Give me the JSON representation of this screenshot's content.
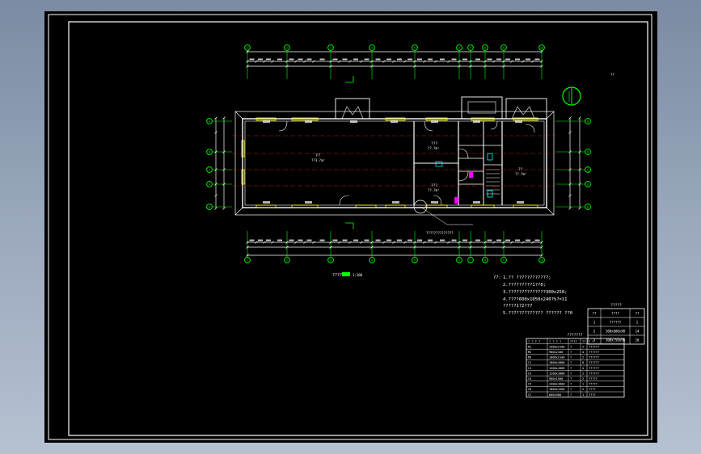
{
  "title_block": {
    "sheet_text": "??",
    "plan_title": "????",
    "plan_scale": "1:100",
    "ellipsis_label": "??????????????",
    "section_a": "A",
    "section_b": "B"
  },
  "rooms": [
    {
      "name": "??",
      "area": "??3.?m²"
    },
    {
      "name": "???",
      "area": "??.?m²"
    },
    {
      "name": "???",
      "area": "??.?m²"
    },
    {
      "name": "??",
      "area": "??.?m²"
    }
  ],
  "axes_top": [
    "1",
    "2",
    "3",
    "4",
    "5",
    "6",
    "7",
    "8",
    "9",
    "10"
  ],
  "axes_side": [
    "A",
    "B",
    "C",
    "D",
    "E"
  ],
  "notes": {
    "heading": "??:",
    "lines": [
      "1.?? ????????????;",
      "2.?????????1??0;",
      "3.??????????????300x250;",
      "4.????600x1050x240?%?=11",
      "   ?????1?2??7",
      "5.?????????????  ??????  ??0"
    ]
  },
  "table_right": {
    "title": "?????",
    "headers": [
      "??",
      "????",
      "??"
    ],
    "rows": [
      [
        "1",
        "??????",
        "1"
      ],
      [
        "2",
        "300x600x90",
        "14"
      ],
      [
        "3",
        "300x750x90",
        "10"
      ]
    ]
  },
  "table_main": {
    "title": "???????",
    "headers": [
      "? ? ? ?",
      "? ? ? ?",
      "????",
      "??",
      "? ?"
    ],
    "rows": [
      [
        "M1",
        "1500x2100",
        "?",
        "2",
        "??????"
      ],
      [
        "M2",
        "900x2100",
        "?",
        "4",
        "??????"
      ],
      [
        "M3",
        "1000x2100",
        "?",
        "2",
        "??????"
      ],
      [
        "C1",
        "1800x1800",
        "?",
        "8",
        "??????"
      ],
      [
        "C2",
        "1500x1800",
        "?",
        "4",
        "??????"
      ],
      [
        "C3",
        "1200x1800",
        "?",
        "2",
        "??????"
      ],
      [
        "C4",
        "900x1500",
        "?",
        "2",
        "?????"
      ],
      [
        "C5",
        "2400x1800",
        "?",
        "1",
        "?????"
      ],
      [
        "C6",
        "1800x1500",
        "?",
        "2",
        "????"
      ],
      [
        "C7",
        "600x900",
        "?",
        "1",
        "????"
      ]
    ]
  },
  "colors": {
    "line_white": "#ffffff",
    "axis_green": "#00ff00",
    "window_yellow": "#ffff00",
    "cyan": "#00ffff",
    "magenta": "#ff00ff",
    "red": "#ff3030"
  }
}
